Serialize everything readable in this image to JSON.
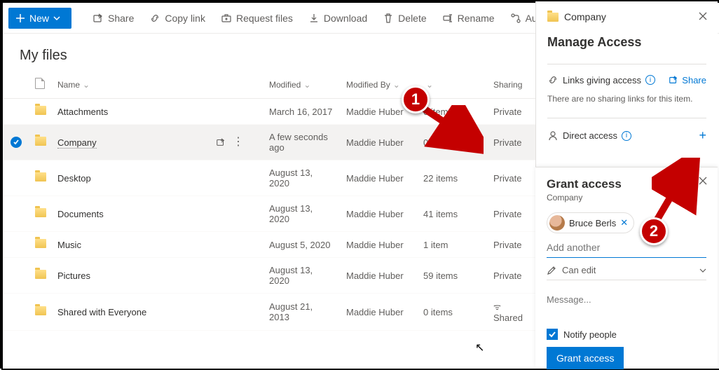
{
  "toolbar": {
    "new": "New",
    "share": "Share",
    "copylink": "Copy link",
    "request": "Request files",
    "download": "Download",
    "delete": "Delete",
    "rename": "Rename",
    "automate": "Automate"
  },
  "page_title": "My files",
  "columns": {
    "name": "Name",
    "modified": "Modified",
    "modifiedby": "Modified By",
    "items": "",
    "sharing": "Sharing"
  },
  "rows": [
    {
      "name": "Attachments",
      "modified": "March 16, 2017",
      "by": "Maddie Huber",
      "items": "0 items",
      "sharing": "Private",
      "sel": false
    },
    {
      "name": "Company",
      "modified": "A few seconds ago",
      "by": "Maddie Huber",
      "items": "0 items",
      "sharing": "Private",
      "sel": true
    },
    {
      "name": "Desktop",
      "modified": "August 13, 2020",
      "by": "Maddie Huber",
      "items": "22 items",
      "sharing": "Private",
      "sel": false
    },
    {
      "name": "Documents",
      "modified": "August 13, 2020",
      "by": "Maddie Huber",
      "items": "41 items",
      "sharing": "Private",
      "sel": false
    },
    {
      "name": "Music",
      "modified": "August 5, 2020",
      "by": "Maddie Huber",
      "items": "1 item",
      "sharing": "Private",
      "sel": false
    },
    {
      "name": "Pictures",
      "modified": "August 13, 2020",
      "by": "Maddie Huber",
      "items": "59 items",
      "sharing": "Private",
      "sel": false
    },
    {
      "name": "Shared with Everyone",
      "modified": "August 21, 2013",
      "by": "Maddie Huber",
      "items": "0 items",
      "sharing": "Shared",
      "sel": false
    }
  ],
  "panel": {
    "folder": "Company",
    "title": "Manage Access",
    "links_heading": "Links giving access",
    "share_label": "Share",
    "no_links": "There are no sharing links for this item.",
    "direct_heading": "Direct access"
  },
  "popup": {
    "title": "Grant access",
    "subtitle": "Company",
    "person": "Bruce Berls",
    "add_placeholder": "Add another",
    "perm": "Can edit",
    "msg_placeholder": "Message...",
    "notify": "Notify people",
    "button": "Grant access"
  },
  "callouts": {
    "one": "1",
    "two": "2"
  }
}
